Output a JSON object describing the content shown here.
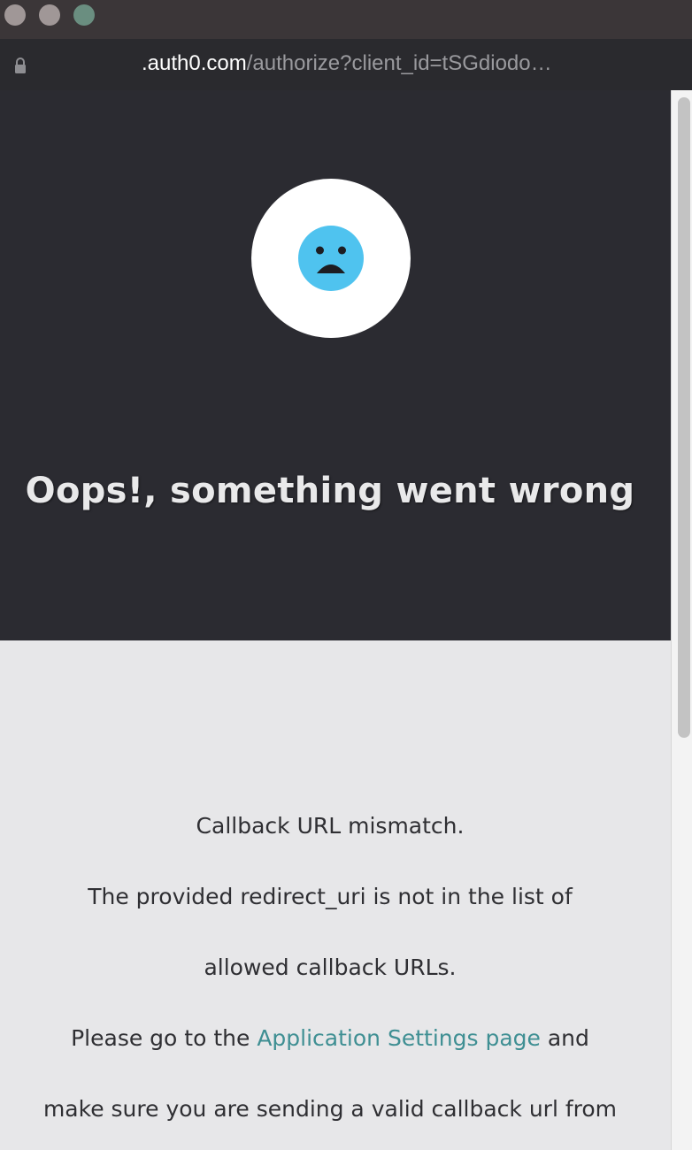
{
  "browser": {
    "url_host": ".auth0.com",
    "url_path": "/authorize?client_id=tSGdiodo…"
  },
  "error_page": {
    "headline": "Oops!, something went wrong",
    "line1": "Callback URL mismatch.",
    "line2": "The provided redirect_uri is not in the list of",
    "line3": "allowed callback URLs.",
    "line4_prefix": "Please go to the ",
    "line4_link": "Application Settings page",
    "line4_suffix": " and",
    "line5": "make sure you are sending a valid callback url from"
  },
  "colors": {
    "hero_bg": "#2b2b31",
    "content_bg": "#e7e7e9",
    "face": "#4fc3ef",
    "link": "#3f8f93"
  },
  "icons": [
    "lock-icon",
    "sad-face-icon"
  ]
}
